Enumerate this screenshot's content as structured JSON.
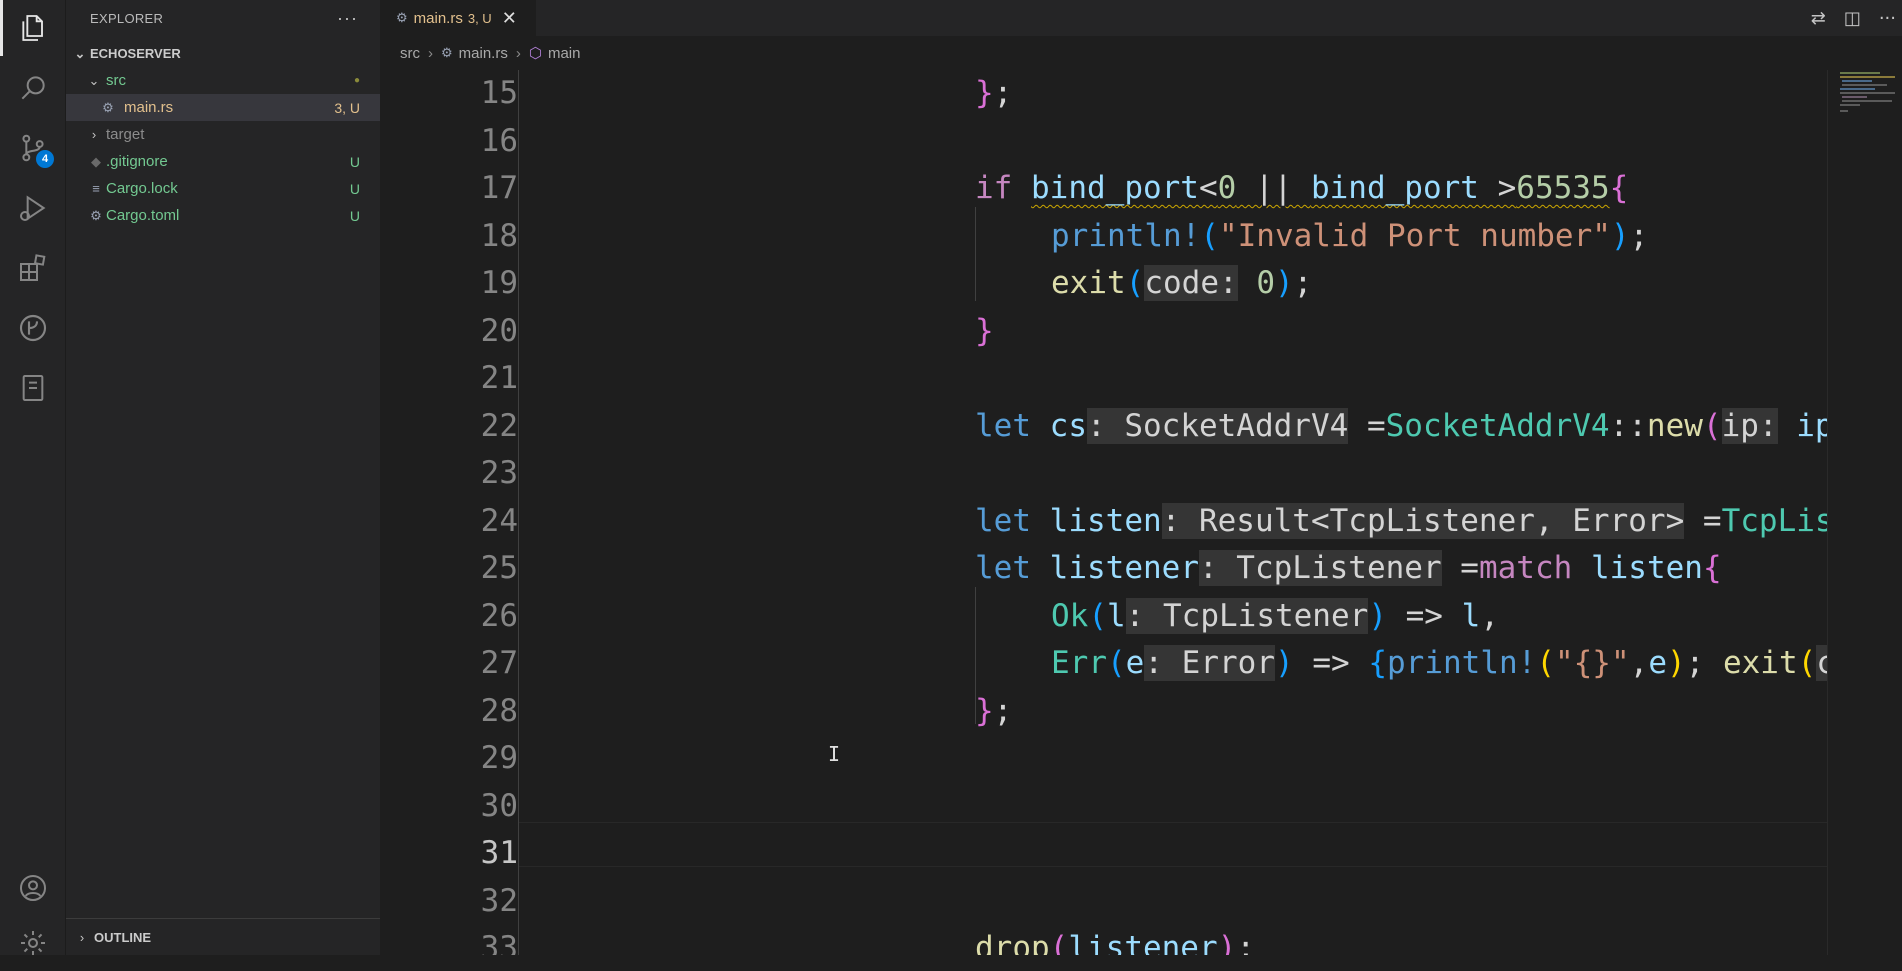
{
  "activity_bar": {
    "scm_badge": "4"
  },
  "sidebar": {
    "title": "EXPLORER",
    "more": "···",
    "root": "ECHOSERVER",
    "items": [
      {
        "label": "src",
        "decoration": "●",
        "color": "#73c991"
      },
      {
        "label": "main.rs",
        "decoration": "3, U",
        "color": "#e2c08d"
      },
      {
        "label": "target",
        "decoration": "",
        "color": "#8c8c8c"
      },
      {
        "label": ".gitignore",
        "decoration": "U",
        "color": "#73c991"
      },
      {
        "label": "Cargo.lock",
        "decoration": "U",
        "color": "#73c991"
      },
      {
        "label": "Cargo.toml",
        "decoration": "U",
        "color": "#73c991"
      }
    ],
    "outline": "OUTLINE"
  },
  "tabs": [
    {
      "label": "main.rs",
      "decoration": "3, U"
    }
  ],
  "breadcrumbs": [
    "src",
    "main.rs",
    "main"
  ],
  "editor": {
    "active_line": 31,
    "line_numbers": [
      "15",
      "16",
      "17",
      "18",
      "19",
      "20",
      "21",
      "22",
      "23",
      "24",
      "25",
      "26",
      "27",
      "28",
      "29",
      "30",
      "31",
      "32",
      "33"
    ]
  },
  "colors": {
    "accent": "#0078d4",
    "untracked": "#73c991",
    "modified": "#e2c08d"
  }
}
